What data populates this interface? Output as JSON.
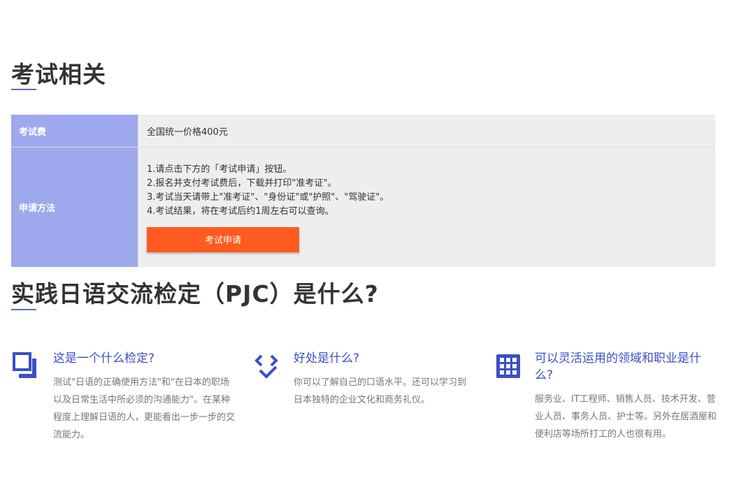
{
  "exam_section": {
    "title": "考试相关",
    "fee_label": "考试费",
    "fee_value": "全国统一价格400元",
    "apply_label": "申请方法",
    "steps": [
      "1.请点击下方的「考试申请」按钮。",
      "2.报名并支付考试费后，下载并打印\"准考证\"。",
      "3.考试当天请带上\"准考证\"、\"身份证\"或\"护照\"、\"驾驶证\"。",
      "4.考试结果，将在考试后约1周左右可以查询。"
    ],
    "apply_button": "考试申请"
  },
  "pjc_section": {
    "title": "实践日语交流检定（PJC）是什么?",
    "features": [
      {
        "icon": "copy-squares-icon",
        "title": "这是一个什么检定?",
        "text": "测试\"日语的正确使用方法\"和\"在日本的职场以及日常生活中所必须的沟通能力\"。在某种程度上理解日语的人，更能看出一步一步的交流能力。"
      },
      {
        "icon": "code-check-icon",
        "title": "好处是什么?",
        "text": "你可以了解自己的口语水平。还可以学习到日本独特的企业文化和商务礼仪。"
      },
      {
        "icon": "grid-icon",
        "title": "可以灵活运用的领域和职业是什么?",
        "text": "服务业、IT工程师、销售人员、技术开发、营业人员、事务人员、护士等。另外在居酒屋和便利店等场所打工的人也很有用。"
      }
    ]
  },
  "colors": {
    "accent": "#3b4fc7",
    "table_header": "#9ea9ed",
    "button": "#ff5a20"
  }
}
